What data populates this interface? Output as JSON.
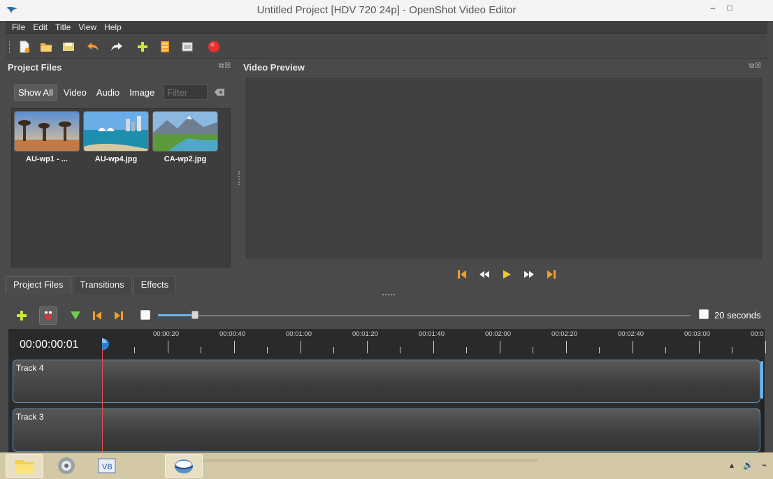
{
  "window": {
    "title": "Untitled Project [HDV 720 24p] - OpenShot Video Editor",
    "minimize_glyph": "–",
    "maximize_glyph": "□"
  },
  "menu": [
    "File",
    "Edit",
    "Title",
    "View",
    "Help"
  ],
  "toolbar_icons": [
    "new-project-icon",
    "open-project-icon",
    "save-project-icon",
    "undo-icon",
    "redo-icon",
    "import-files-icon",
    "profile-icon",
    "fullscreen-icon",
    "export-video-icon"
  ],
  "project_files": {
    "header": "Project Files",
    "filters": [
      "Show All",
      "Video",
      "Audio",
      "Image"
    ],
    "filter_placeholder": "Filter",
    "files": [
      {
        "name": "AU-wp1 - ...",
        "thumb": "baobab-trees"
      },
      {
        "name": "AU-wp4.jpg",
        "thumb": "sydney-harbour"
      },
      {
        "name": "CA-wp2.jpg",
        "thumb": "mountain-stream"
      }
    ]
  },
  "bottom_tabs": [
    "Project Files",
    "Transitions",
    "Effects"
  ],
  "video_preview": {
    "header": "Video Preview"
  },
  "timeline": {
    "zoom_label": "20 seconds",
    "zoom_fraction": 0.07,
    "current_time": "00:00:00:01",
    "ruler_labels": [
      "00:00:20",
      "00:00:40",
      "00:01:00",
      "00:01:20",
      "00:01:40",
      "00:02:00",
      "00:02:20",
      "00:02:40",
      "00:03:00",
      "00:0"
    ],
    "tracks": [
      "Track 4",
      "Track 3"
    ]
  },
  "colors": {
    "accent": "#6ab3f0",
    "playhead": "#e94b4b",
    "icon_orange": "#f39c2a",
    "icon_green": "#8fd13f"
  }
}
